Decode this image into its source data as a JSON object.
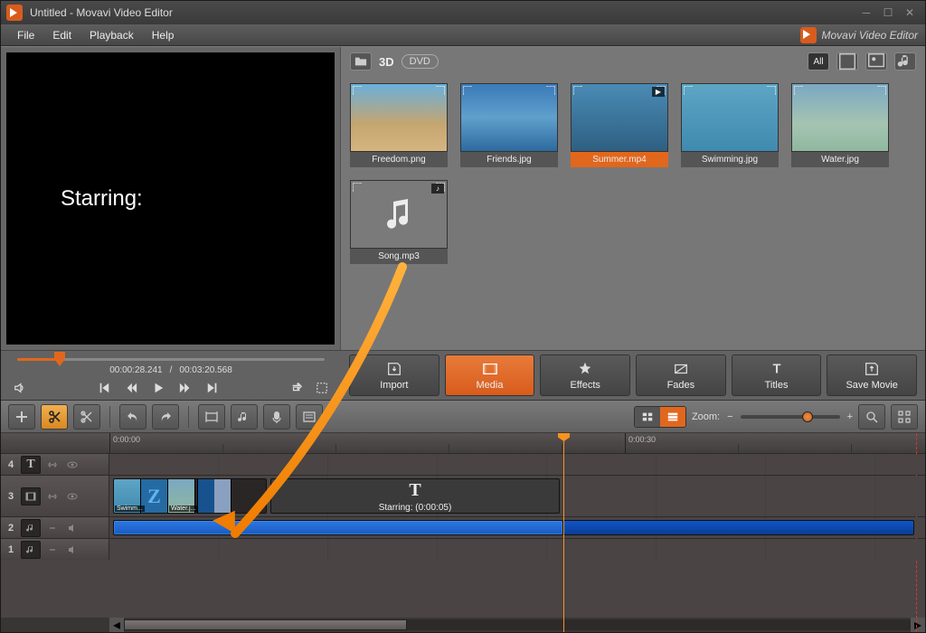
{
  "window_title": "Untitled - Movavi Video Editor",
  "brand_text": "Movavi Video Editor",
  "menus": {
    "file": "File",
    "edit": "Edit",
    "playback": "Playback",
    "help": "Help"
  },
  "preview": {
    "overlay_text": "Starring:"
  },
  "media_toolbar": {
    "threed": "3D",
    "dvd": "DVD",
    "all": "All"
  },
  "thumbs": [
    {
      "label": "Freedom.png",
      "cls": "beach"
    },
    {
      "label": "Friends.jpg",
      "cls": "friends"
    },
    {
      "label": "Summer.mp4",
      "cls": "summer",
      "selected": true,
      "video": true
    },
    {
      "label": "Swimming.jpg",
      "cls": "swim"
    },
    {
      "label": "Water.jpg",
      "cls": "water"
    },
    {
      "label": "Song.mp3",
      "cls": "music",
      "music": true
    }
  ],
  "timecode": {
    "current": "00:00:28.241",
    "total": "00:03:20.568"
  },
  "tabs": {
    "import": "Import",
    "media": "Media",
    "effects": "Effects",
    "fades": "Fades",
    "titles": "Titles",
    "save": "Save Movie"
  },
  "zoom_label": "Zoom:",
  "ruler": {
    "t0": "0:00:00",
    "t30": "0:00:30"
  },
  "tracks": {
    "t4": "4",
    "t3": "3",
    "t2": "2",
    "t1": "1"
  },
  "clip_labels": {
    "swim": "Swimm...",
    "water": "Water.j...",
    "title_top": "T",
    "title_caption": "Starring: (0:00:05)"
  }
}
